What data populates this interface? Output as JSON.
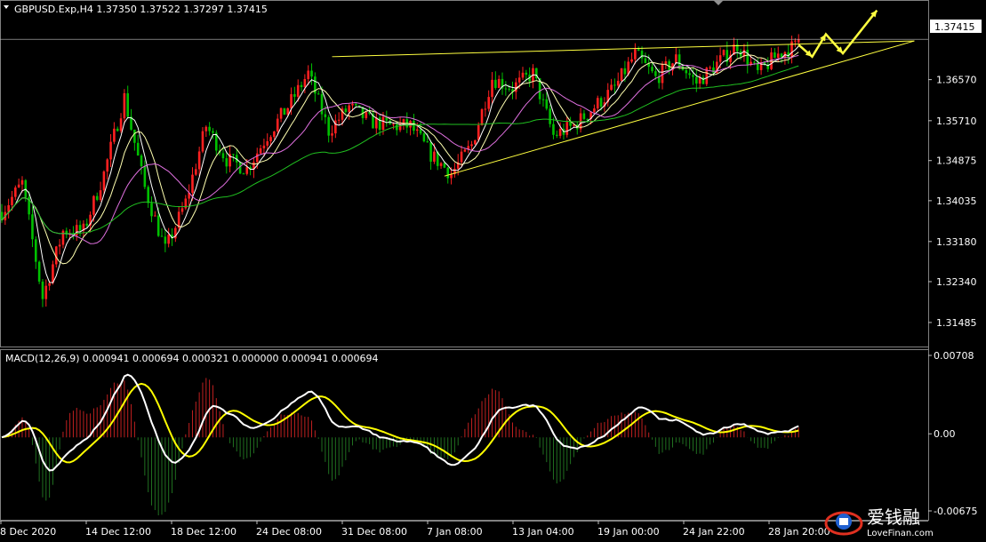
{
  "header": {
    "symbol_line": "GBPUSD.Exp,H4  1.37350 1.37522 1.37297 1.37415",
    "macd_line": "MACD(12,26,9) 0.000941 0.000694 0.000321 0.000000 0.000941 0.000694"
  },
  "colors": {
    "background": "#000000",
    "bull": "#ff2020",
    "bear": "#00c000",
    "ma_fast": "#ffffff",
    "ma_mid": "#ffffb0",
    "ma_slow": "#e070e0",
    "ma_long": "#20c020",
    "trend": "#ffff40",
    "macd_line": "#ffffff",
    "signal_line": "#ffff00",
    "hist_pos": "#c02020",
    "hist_neg": "#207020"
  },
  "watermark": {
    "brand": "爱钱融",
    "site": "LoveFinan.com"
  },
  "chart_data": [
    {
      "type": "candlestick",
      "title": "GBPUSD.Exp,H4",
      "ohlc_last": {
        "open": 1.3735,
        "high": 1.37522,
        "low": 1.37297,
        "close": 1.37415
      },
      "current_price": "1.37415",
      "y_tick_labels": [
        "1.36570",
        "1.35710",
        "1.34875",
        "1.34035",
        "1.33180",
        "1.32340",
        "1.31485"
      ],
      "ylim": [
        1.31,
        1.382
      ],
      "x_tick_labels": [
        "8 Dec 2020",
        "14 Dec 12:00",
        "18 Dec 12:00",
        "24 Dec 08:00",
        "31 Dec 08:00",
        "7 Jan 08:00",
        "13 Jan 04:00",
        "19 Jan 00:00",
        "24 Jan 22:00",
        "28 Jan 20:00"
      ],
      "close_path_anchors": [
        [
          0,
          1.338
        ],
        [
          6,
          1.344
        ],
        [
          12,
          1.32
        ],
        [
          18,
          1.334
        ],
        [
          24,
          1.334
        ],
        [
          30,
          1.346
        ],
        [
          36,
          1.362
        ],
        [
          42,
          1.343
        ],
        [
          48,
          1.33
        ],
        [
          54,
          1.34
        ],
        [
          60,
          1.356
        ],
        [
          66,
          1.349
        ],
        [
          72,
          1.347
        ],
        [
          78,
          1.354
        ],
        [
          84,
          1.36
        ],
        [
          90,
          1.367
        ],
        [
          96,
          1.355
        ],
        [
          102,
          1.36
        ],
        [
          108,
          1.357
        ],
        [
          114,
          1.356
        ],
        [
          120,
          1.356
        ],
        [
          126,
          1.35
        ],
        [
          132,
          1.346
        ],
        [
          138,
          1.352
        ],
        [
          144,
          1.366
        ],
        [
          150,
          1.364
        ],
        [
          156,
          1.367
        ],
        [
          162,
          1.354
        ],
        [
          168,
          1.356
        ],
        [
          174,
          1.36
        ],
        [
          180,
          1.364
        ],
        [
          186,
          1.371
        ],
        [
          192,
          1.366
        ],
        [
          198,
          1.37
        ],
        [
          204,
          1.365
        ],
        [
          210,
          1.369
        ],
        [
          216,
          1.373
        ],
        [
          222,
          1.367
        ],
        [
          228,
          1.371
        ],
        [
          234,
          1.373
        ]
      ],
      "bar_count": 235,
      "trendlines": [
        {
          "from": [
            97,
            1.3705
          ],
          "to": [
            268,
            1.3738
          ]
        },
        {
          "from": [
            130,
            1.3455
          ],
          "to": [
            268,
            1.3738
          ]
        }
      ],
      "projection": [
        [
          234,
          1.373
        ],
        [
          238,
          1.3705
        ],
        [
          242,
          1.3752
        ],
        [
          247,
          1.3712
        ],
        [
          257,
          1.3802
        ]
      ]
    },
    {
      "type": "macd",
      "title": "MACD(12,26,9)",
      "params": [
        12,
        26,
        9
      ],
      "values": {
        "macd": 0.000941,
        "signal": 0.000694,
        "histogram": 0.000321
      },
      "y_tick_labels": [
        "0.00708",
        "0.00",
        "-0.00675"
      ],
      "ylim": [
        -0.00675,
        0.00708
      ]
    }
  ]
}
